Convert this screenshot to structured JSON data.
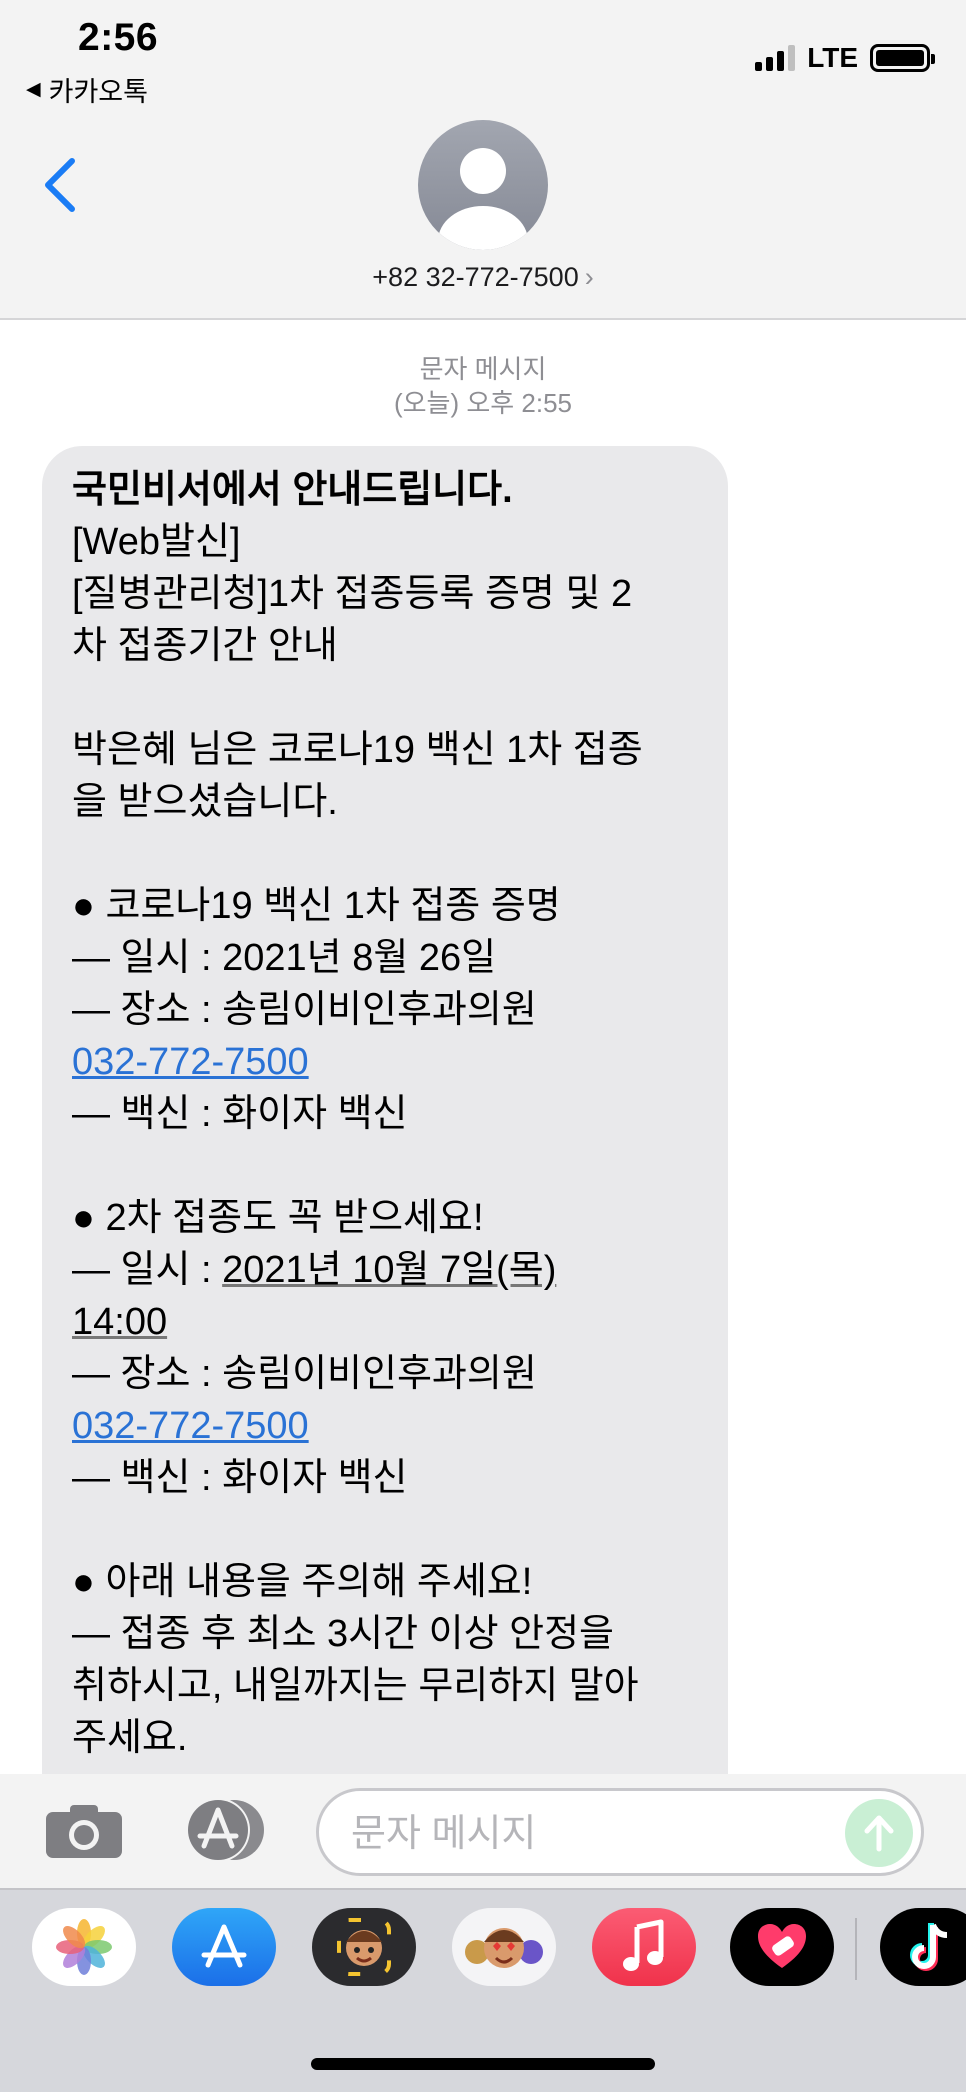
{
  "status_bar": {
    "time": "2:56",
    "back_app": "카카오톡",
    "network": "LTE"
  },
  "header": {
    "contact": "+82 32-772-7500",
    "chevron": "›"
  },
  "conversation": {
    "type_label": "문자 메시지",
    "timestamp": "(오늘) 오후 2:55"
  },
  "message": {
    "title": "국민비서에서 안내드립니다.",
    "line_web": "[Web발신]",
    "line_header1": "[질병관리청]1차 접종등록 증명 및 2",
    "line_header2": "차 접종기간 안내",
    "line_intro1": "박은혜 님은 코로나19 백신 1차 접종",
    "line_intro2": "을 받으셨습니다.",
    "sec1_title": "● 코로나19 백신 1차 접종 증명",
    "sec1_date": "— 일시 : 2021년 8월 26일",
    "sec1_place": "— 장소 : 송림이비인후과의원",
    "sec1_phone": "032-772-7500",
    "sec1_vaccine": "— 백신 : 화이자 백신",
    "sec2_title": "● 2차 접종도 꼭 받으세요!",
    "sec2_date_prefix": "— 일시 : ",
    "sec2_date": "2021년 10월 7일(목)",
    "sec2_time": "14:00",
    "sec2_place": "— 장소 : 송림이비인후과의원",
    "sec2_phone": "032-772-7500",
    "sec2_vaccine": "— 백신 : 화이자 백신",
    "sec3_title": "● 아래 내용을 주의해 주세요!",
    "sec3_line1": "— 접종 후 최소 3시간 이상 안정을",
    "sec3_line2": "취하시고, 내일까지는 무리하지 말아",
    "sec3_line3": "주세요."
  },
  "compose": {
    "placeholder": "문자 메시지"
  },
  "app_drawer": {
    "apps": [
      "photos-icon",
      "app-store-icon",
      "memoji-icon",
      "memoji-stickers-icon",
      "music-icon",
      "heart-sticker-icon",
      "tiktok-icon"
    ]
  },
  "colors": {
    "link": "#2a72d5",
    "bubble": "#e9e9eb",
    "accent": "#1a7cf5",
    "send_disabled": "#c9efd4"
  }
}
